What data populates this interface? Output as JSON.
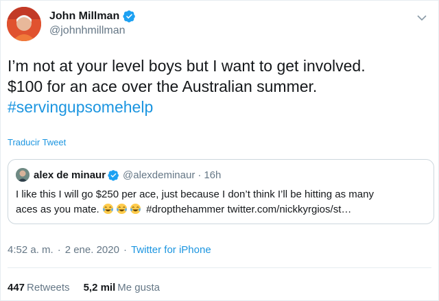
{
  "author": {
    "name": "John Millman",
    "handle": "@johnhmillman"
  },
  "tweet": {
    "line1": "I’m not at your level boys but I want to get involved.",
    "line2": "$100 for an ace over the Australian summer.",
    "hashtag": "#servingupsomehelp"
  },
  "translate_label": "Traducir Tweet",
  "quote": {
    "name": "alex de minaur",
    "handle": "@alexdeminaur",
    "separator": "·",
    "time": "16h",
    "line1": "I like this I will go $250 per ace, just because I don’t think I’ll be hitting as many",
    "line2_start": "aces as you mate.",
    "emojis": [
      "tears-of-joy-emoji",
      "tears-of-joy-emoji",
      "tears-of-joy-emoji"
    ],
    "hashtag": "#dropthehammer",
    "link": "twitter.com/nickkyrgios/st…"
  },
  "meta": {
    "time": "4:52 a. m.",
    "dot1": "·",
    "date": "2 ene. 2020",
    "dot2": "·",
    "source": "Twitter for iPhone"
  },
  "stats": {
    "retweets_count": "447",
    "retweets_label": "Retweets",
    "likes_count": "5,2 mil",
    "likes_label": "Me gusta"
  },
  "colors": {
    "link_blue": "#1b95e0",
    "verified_blue": "#1da1f2",
    "secondary_gray": "#657786",
    "border": "#ccd6dd"
  }
}
